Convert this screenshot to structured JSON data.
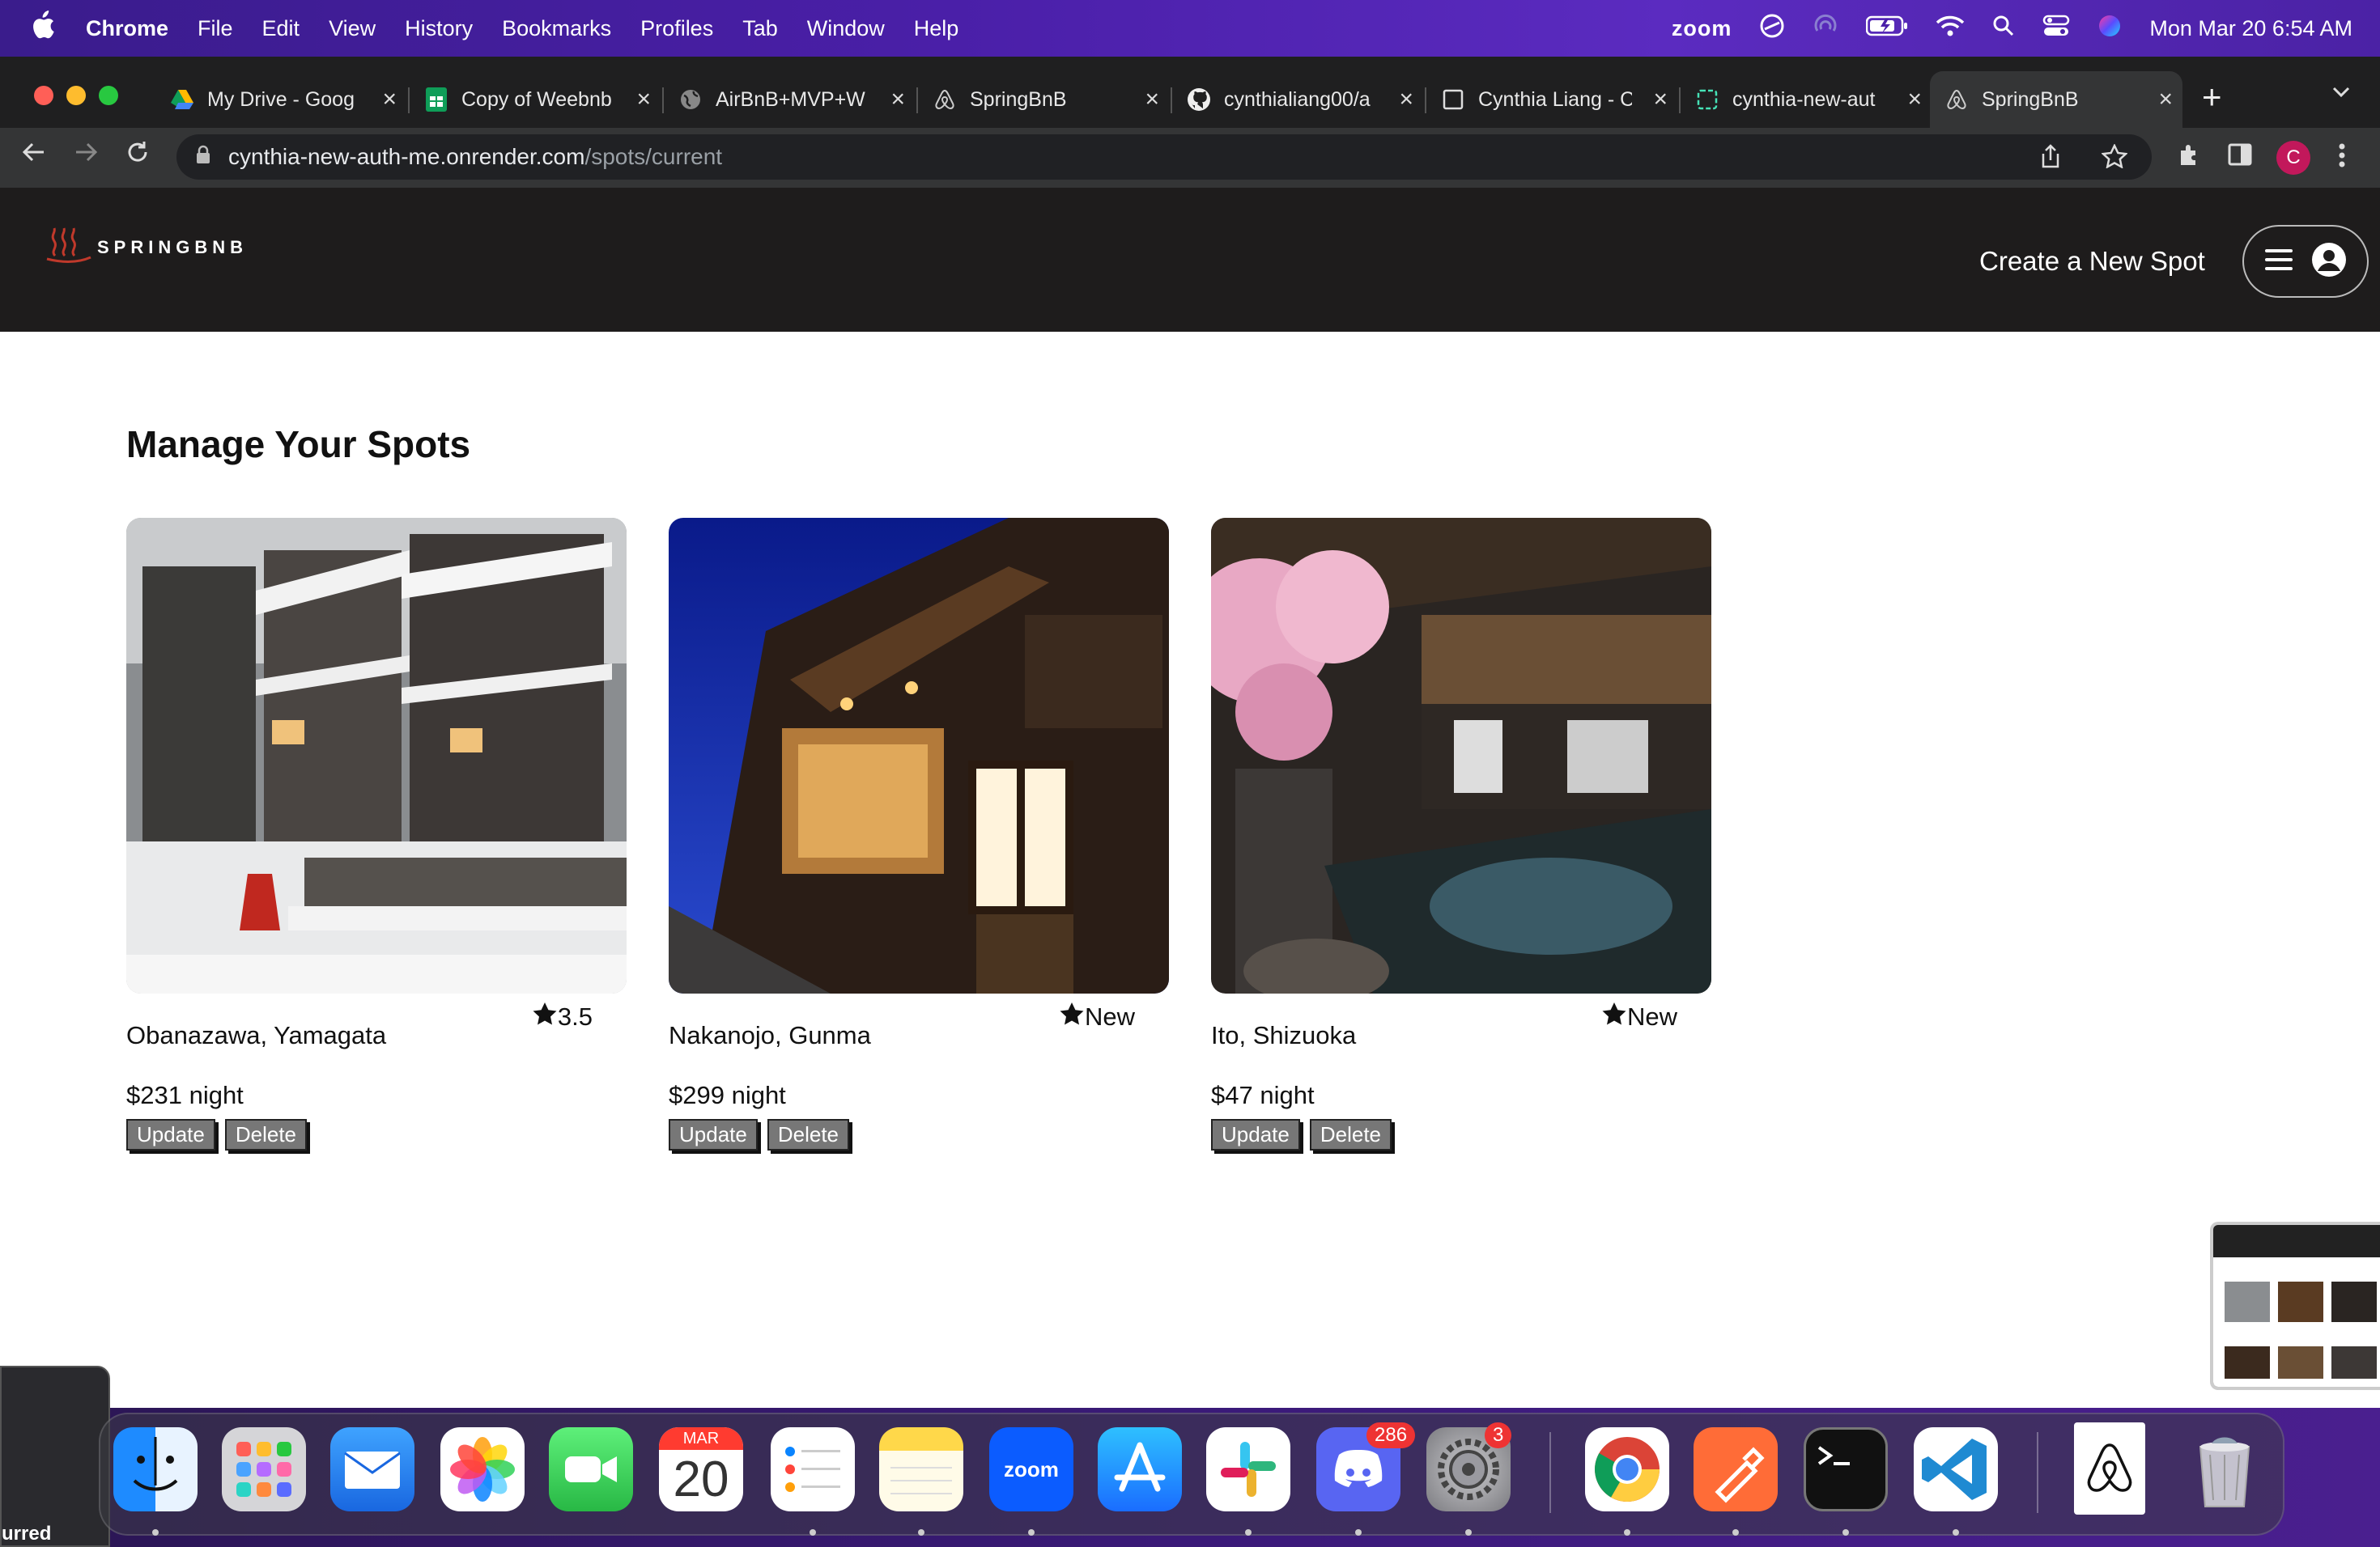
{
  "menubar": {
    "app": "Chrome",
    "items": [
      "File",
      "Edit",
      "View",
      "History",
      "Bookmarks",
      "Profiles",
      "Tab",
      "Window",
      "Help"
    ],
    "zoom_label": "zoom",
    "clock": "Mon Mar 20  6:54 AM"
  },
  "tabs": [
    {
      "title": "My Drive - Goog"
    },
    {
      "title": "Copy of Weebnb"
    },
    {
      "title": "AirBnB+MVP+W"
    },
    {
      "title": "SpringBnB"
    },
    {
      "title": "cynthialiang00/a"
    },
    {
      "title": "Cynthia Liang - C"
    },
    {
      "title": "cynthia-new-aut"
    },
    {
      "title": "SpringBnB"
    }
  ],
  "address": {
    "host": "cynthia-new-auth-me.onrender.com",
    "path": "/spots/current"
  },
  "profile_initial": "C",
  "site": {
    "logo_text": "SPRINGBNB",
    "create_spot": "Create a New Spot"
  },
  "page": {
    "title": "Manage Your Spots",
    "update_label": "Update",
    "delete_label": "Delete",
    "spots": [
      {
        "location": "Obanazawa, Yamagata",
        "rating": "3.5",
        "price": "$231 night"
      },
      {
        "location": "Nakanojo, Gunma",
        "rating": "New",
        "price": "$299 night"
      },
      {
        "location": "Ito, Shizuoka",
        "rating": "New",
        "price": "$47 night"
      }
    ]
  },
  "dock": {
    "calendar_month": "MAR",
    "calendar_day": "20",
    "zoom_label": "zoom",
    "discord_badge": "286",
    "settings_badge": "3"
  },
  "left_widget_text": "urred"
}
